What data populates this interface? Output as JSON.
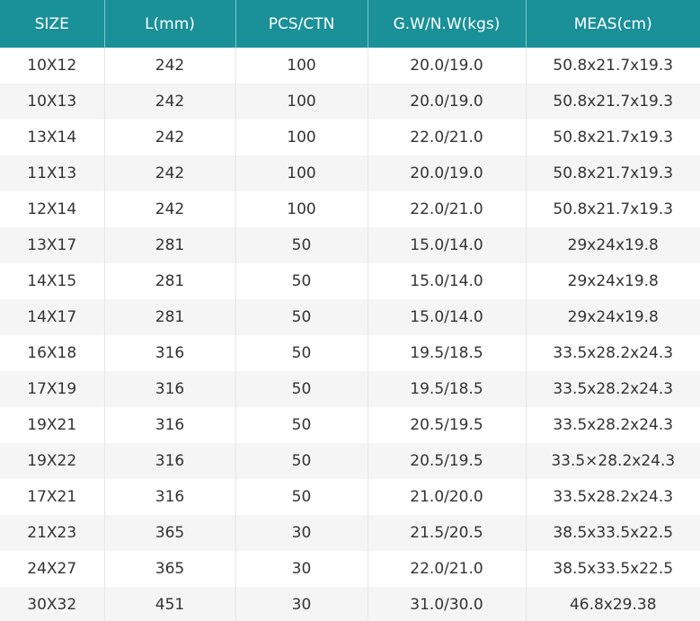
{
  "table": {
    "headers": [
      "SIZE",
      "L(mm)",
      "PCS/CTN",
      "G.W/N.W(kgs)",
      "MEAS(cm)"
    ],
    "rows": [
      [
        "10X12",
        "242",
        "100",
        "20.0/19.0",
        "50.8x21.7x19.3"
      ],
      [
        "10X13",
        "242",
        "100",
        "20.0/19.0",
        "50.8x21.7x19.3"
      ],
      [
        "13X14",
        "242",
        "100",
        "22.0/21.0",
        "50.8x21.7x19.3"
      ],
      [
        "11X13",
        "242",
        "100",
        "20.0/19.0",
        "50.8x21.7x19.3"
      ],
      [
        "12X14",
        "242",
        "100",
        "22.0/21.0",
        "50.8x21.7x19.3"
      ],
      [
        "13X17",
        "281",
        "50",
        "15.0/14.0",
        "29x24x19.8"
      ],
      [
        "14X15",
        "281",
        "50",
        "15.0/14.0",
        "29x24x19.8"
      ],
      [
        "14X17",
        "281",
        "50",
        "15.0/14.0",
        "29x24x19.8"
      ],
      [
        "16X18",
        "316",
        "50",
        "19.5/18.5",
        "33.5x28.2x24.3"
      ],
      [
        "17X19",
        "316",
        "50",
        "19.5/18.5",
        "33.5x28.2x24.3"
      ],
      [
        "19X21",
        "316",
        "50",
        "20.5/19.5",
        "33.5x28.2x24.3"
      ],
      [
        "19X22",
        "316",
        "50",
        "20.5/19.5",
        "33.5×28.2x24.3"
      ],
      [
        "17X21",
        "316",
        "50",
        "21.0/20.0",
        "33.5x28.2x24.3"
      ],
      [
        "21X23",
        "365",
        "30",
        "21.5/20.5",
        "38.5x33.5x22.5"
      ],
      [
        "24X27",
        "365",
        "30",
        "22.0/21.0",
        "38.5x33.5x22.5"
      ],
      [
        "30X32",
        "451",
        "30",
        "31.0/30.0",
        "46.8x29.38"
      ]
    ]
  },
  "colors": {
    "header_background": "#1a9098",
    "header_text": "#ffffff",
    "row_alt_background": "#f5f5f5",
    "body_text": "#333333"
  }
}
